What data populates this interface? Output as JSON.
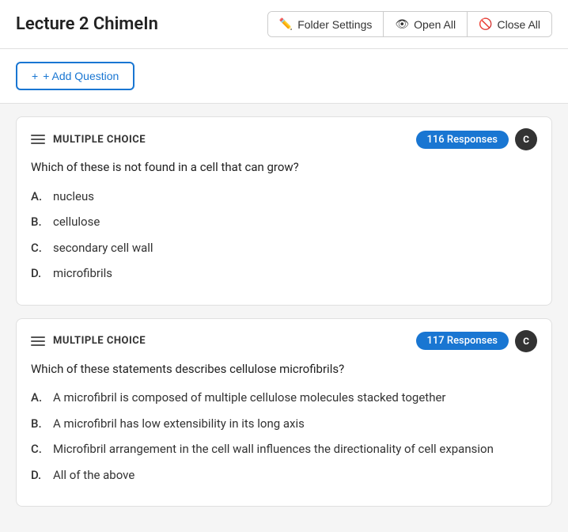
{
  "header": {
    "title": "Lecture 2 ChimeIn",
    "folder_settings_label": "Folder Settings",
    "open_all_label": "Open All",
    "close_all_label": "Close All"
  },
  "toolbar": {
    "add_question_label": "+ Add Question"
  },
  "questions": [
    {
      "type_label": "MULTIPLE CHOICE",
      "responses_count": "116 Responses",
      "question_text": "Which of these is not found in a cell that can grow?",
      "options": [
        {
          "letter": "A.",
          "text": "nucleus"
        },
        {
          "letter": "B.",
          "text": "cellulose"
        },
        {
          "letter": "C.",
          "text": "secondary cell wall"
        },
        {
          "letter": "D.",
          "text": "microfibrils"
        }
      ]
    },
    {
      "type_label": "MULTIPLE CHOICE",
      "responses_count": "117 Responses",
      "question_text": "Which of these statements describes cellulose microfibrils?",
      "options": [
        {
          "letter": "A.",
          "text": "A microfibril is composed of multiple cellulose molecules stacked together"
        },
        {
          "letter": "B.",
          "text": "A microfibril has low extensibility in its long axis"
        },
        {
          "letter": "C.",
          "text": "Microfibril arrangement in the cell wall influences the directionality of cell expansion"
        },
        {
          "letter": "D.",
          "text": "All of the above"
        }
      ]
    }
  ]
}
